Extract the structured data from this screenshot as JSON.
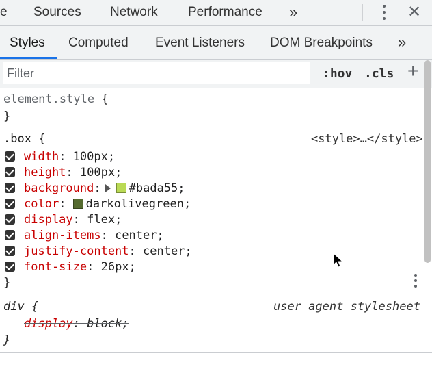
{
  "top_tabs": {
    "partial": "e",
    "sources": "Sources",
    "network": "Network",
    "performance": "Performance",
    "more": "»",
    "close": "✕"
  },
  "sub_tabs": {
    "styles": "Styles",
    "computed": "Computed",
    "event_listeners": "Event Listeners",
    "dom_breakpoints": "DOM Breakpoints",
    "more": "»"
  },
  "toolbar": {
    "filter_placeholder": "Filter",
    "hov": ":hov",
    "cls": ".cls",
    "add": "+"
  },
  "rules": {
    "element_style": {
      "selector": "element.style",
      "open": " {",
      "close": "}"
    },
    "box": {
      "selector": ".box",
      "open": " {",
      "close": "}",
      "source": "<style>…</style>",
      "declarations": [
        {
          "name": "width",
          "value": "100px"
        },
        {
          "name": "height",
          "value": "100px"
        },
        {
          "name": "background",
          "value": "#bada55",
          "swatch": "#bada55"
        },
        {
          "name": "color",
          "value": "darkolivegreen",
          "swatch": "#556b2f"
        },
        {
          "name": "display",
          "value": "flex"
        },
        {
          "name": "align-items",
          "value": "center"
        },
        {
          "name": "justify-content",
          "value": "center"
        },
        {
          "name": "font-size",
          "value": "26px"
        }
      ]
    },
    "div": {
      "selector": "div",
      "open": " {",
      "close": "}",
      "source": "user agent stylesheet",
      "declarations": [
        {
          "name": "display",
          "value": "block"
        }
      ]
    }
  },
  "colors": {
    "accent": "#1a73e8",
    "property": "#c80000",
    "toolbar_bg": "#f1f3f4"
  }
}
